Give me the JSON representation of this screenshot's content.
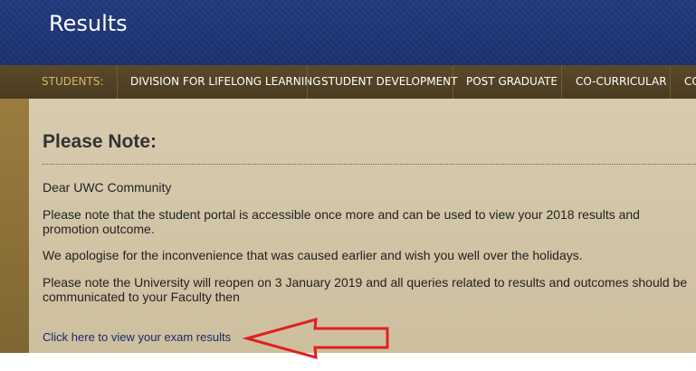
{
  "header": {
    "title": "Results"
  },
  "nav": {
    "section_label": "STUDENTS:",
    "items": [
      "DIVISION FOR LIFELONG LEARNING",
      "STUDENT DEVELOPMENT",
      "POST GRADUATE",
      "CO-CURRICULAR",
      "CO"
    ]
  },
  "content": {
    "heading": "Please Note:",
    "paragraphs": [
      "Dear UWC Community",
      "Please note that the student portal is accessible once more and can be used to view your 2018 results and promotion outcome.",
      "We apologise for the inconvenience that was caused earlier and wish you well over the holidays.",
      "Please note the University will reopen on 3 January 2019 and all queries related to results and outcomes should be communicated to your Faculty then"
    ],
    "link": "Click here to view your exam results"
  },
  "colors": {
    "header_bg": "#1f3576",
    "nav_bg": "#4f3f22",
    "nav_label": "#d4b46a",
    "content_bg": "#d3c6a8",
    "arrow": "#e02020"
  }
}
